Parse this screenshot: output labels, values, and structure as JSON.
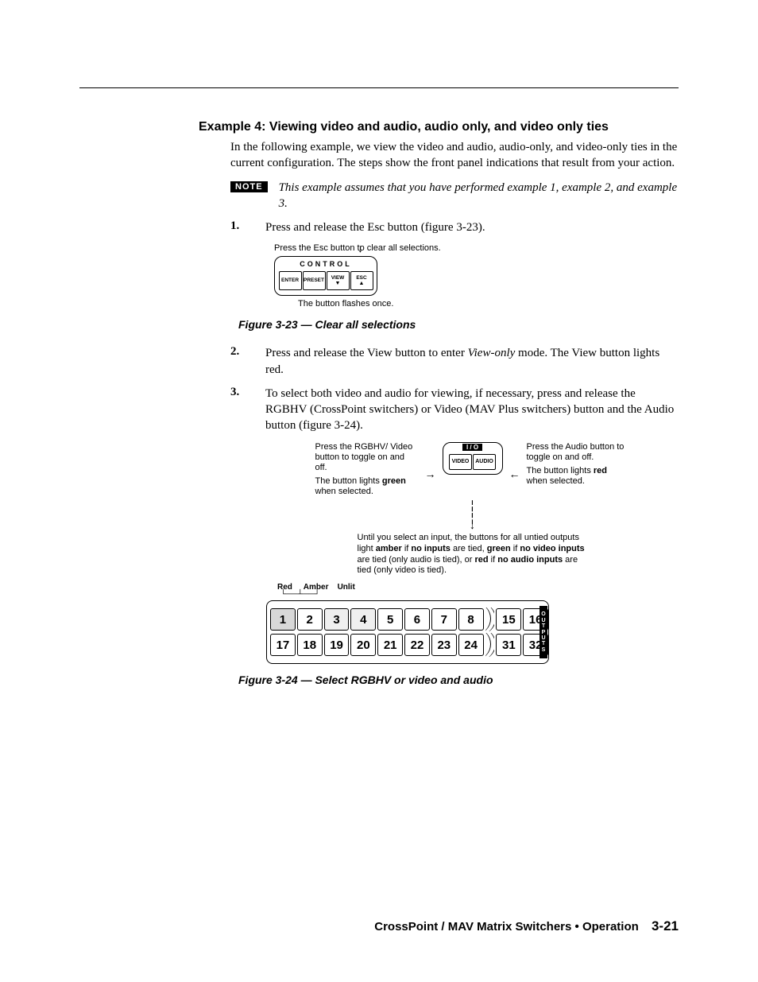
{
  "heading": "Example 4: Viewing video and audio, audio only, and video only ties",
  "intro": "In the following example, we view the video and audio, audio-only, and video-only ties in the current configuration.  The steps show the front panel indications that result from your action.",
  "note_badge": "NOTE",
  "note_text": "This example assumes that you have performed example 1, example 2, and example 3.",
  "steps": {
    "s1_num": "1.",
    "s1_text": "Press and release the Esc button (figure 3-23).",
    "s2_num": "2.",
    "s2_text_a": "Press and release the View button to enter ",
    "s2_text_italic": "View-only",
    "s2_text_b": " mode.  The View button lights red.",
    "s3_num": "3.",
    "s3_text": "To select both video and audio for viewing, if necessary, press and release the RGBHV (CrossPoint switchers) or Video (MAV Plus switchers) button and the Audio button (figure 3-24)."
  },
  "fig23": {
    "top_caption": "Press the Esc button to clear all selections.",
    "panel_label": "CONTROL",
    "btn1": "ENTER",
    "btn2": "PRESET",
    "btn3": "VIEW",
    "btn4": "ESC",
    "bot_caption": "The button flashes once.",
    "caption": "Figure 3-23 — Clear all selections"
  },
  "fig24": {
    "left_text_1": "Press the RGBHV/ Video button to toggle on and off.",
    "left_text_2a": "The button lights ",
    "left_text_2b": "green",
    "left_text_2c": " when selected.",
    "right_text_1": "Press the Audio button to toggle on and off.",
    "right_text_2a": "The button lights ",
    "right_text_2b": "red",
    "right_text_2c": " when selected.",
    "io_label": "I / O",
    "io_btn1": "VIDEO",
    "io_btn2": "AUDIO",
    "mid_1a": "Until you select an input, the buttons for all untied outputs light ",
    "mid_1b": "amber",
    "mid_1c": " if ",
    "mid_1d": "no inputs",
    "mid_1e": " are tied, ",
    "mid_1f": "green",
    "mid_1g": " if ",
    "mid_2a": "no video inputs",
    "mid_2b": " are tied (only audio is tied), or ",
    "mid_3a": "red",
    "mid_3b": " if ",
    "mid_3c": "no audio inputs",
    "mid_3d": " are tied (only video is tied).",
    "legend_red": "Red",
    "legend_amber": "Amber",
    "legend_unlit": "Unlit",
    "row1": [
      "1",
      "2",
      "3",
      "4",
      "5",
      "6",
      "7",
      "8",
      "15",
      "16"
    ],
    "row2": [
      "17",
      "18",
      "19",
      "20",
      "21",
      "22",
      "23",
      "24",
      "31",
      "32"
    ],
    "outputs_label": "OUTPUTS",
    "caption": "Figure 3-24 — Select RGBHV or video and audio"
  },
  "footer_text": "CrossPoint / MAV Matrix Switchers • Operation",
  "footer_page": "3-21"
}
